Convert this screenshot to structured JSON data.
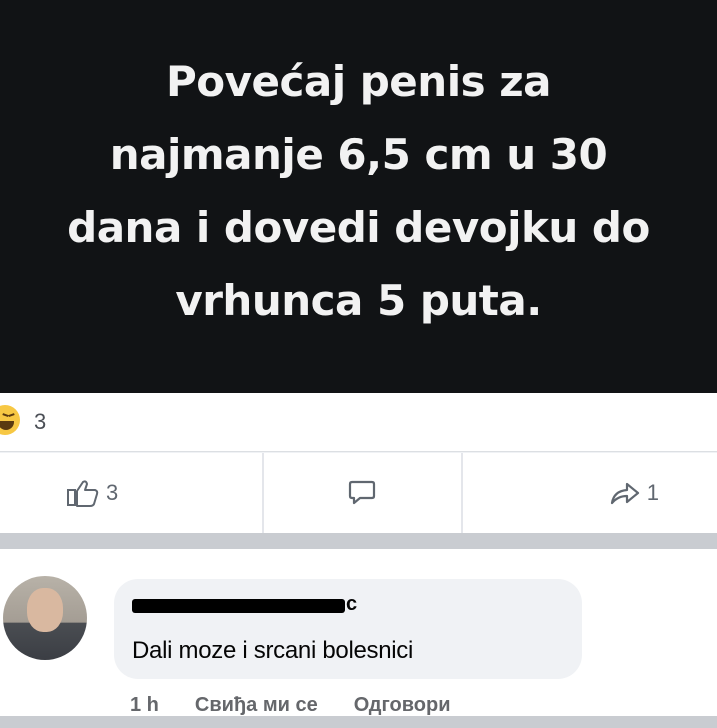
{
  "post": {
    "text": "Povećaj penis za\nnajmanje 6,5 cm u 30\ndana i dovedi devojku do\nvrhunca 5 puta."
  },
  "reactions": {
    "icon": "haha-icon",
    "count": "3"
  },
  "actions": {
    "like": {
      "icon": "thumbs-up-icon",
      "count": "3"
    },
    "comment": {
      "icon": "comment-icon"
    },
    "share": {
      "icon": "share-icon",
      "count": "1"
    }
  },
  "comment": {
    "author_visible": "c",
    "text": "Dali moze i srcani bolesnici",
    "time": "1 h",
    "like_label": "Свиђа ми се",
    "reply_label": "Одговори"
  }
}
